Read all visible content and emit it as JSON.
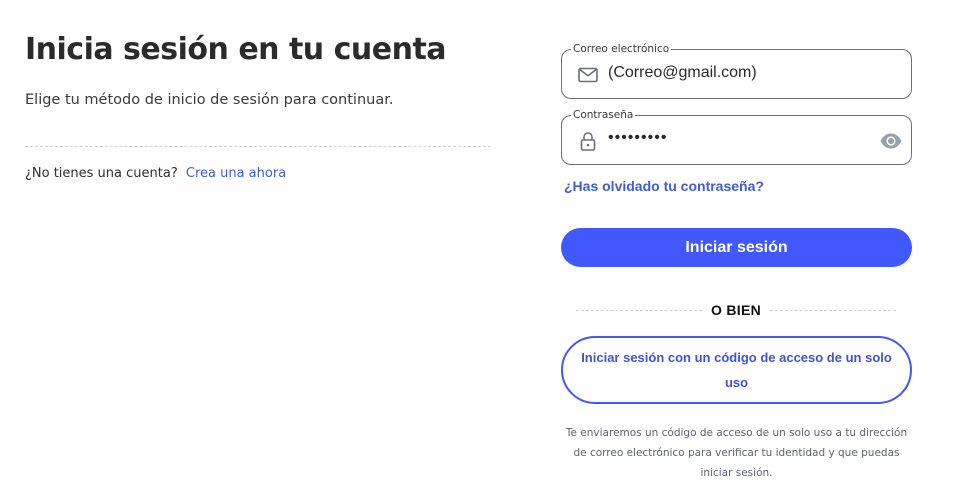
{
  "header": {
    "title": "Inicia sesión en tu cuenta",
    "subtitle": "Elige tu método de inicio de sesión para continuar."
  },
  "signup": {
    "question": "¿No tienes una cuenta?",
    "link_label": "Crea una ahora"
  },
  "email_field": {
    "label": "Correo electrónico",
    "value": "(Correo@gmail.com)",
    "icon": "mail-icon"
  },
  "password_field": {
    "label": "Contraseña",
    "value": "•••••••••",
    "icon": "lock-icon",
    "toggle_icon": "eye-icon"
  },
  "forgot_password": "¿Has olvidado tu contraseña?",
  "login_button": "Iniciar sesión",
  "separator": "O BIEN",
  "otp_button": "Iniciar sesión con un código de acceso de un solo uso",
  "otp_note": "Te enviaremos un código de acceso de un solo uso a tu dirección de correo electrónico para verificar tu identidad y que puedas iniciar sesión.",
  "colors": {
    "accent": "#4058fd",
    "link": "#3f5be0",
    "text": "#2e2e2e",
    "muted": "#5e6270"
  }
}
